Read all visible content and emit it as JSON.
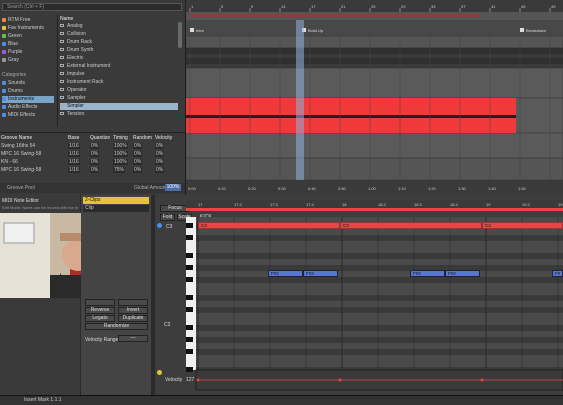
{
  "browser": {
    "search_placeholder": "Search (Ctrl + F)",
    "collections": [
      {
        "label": "RTM Free",
        "color": "#e8913a"
      },
      {
        "label": "Fav Instruments",
        "color": "#e8c33a"
      },
      {
        "label": "Green",
        "color": "#5fc24a"
      },
      {
        "label": "Blue",
        "color": "#4a8fe8"
      },
      {
        "label": "Purple",
        "color": "#9a5ad0"
      },
      {
        "label": "Gray",
        "color": "#9a9a9a"
      }
    ],
    "categories_heading": "Categories",
    "categories": [
      "Sounds",
      "Drums",
      "Instruments",
      "Audio Effects",
      "MIDI Effects"
    ],
    "selected_category": "Instruments",
    "column_header": "Name",
    "items": [
      "Analog",
      "Collision",
      "Drum Rack",
      "Drum Synth",
      "Electric",
      "External Instrument",
      "Impulse",
      "Instrument Rack",
      "Operator",
      "Sampler",
      "Simpler",
      "Tension"
    ],
    "selected_item": "Simpler"
  },
  "groove_pool": {
    "columns": [
      "Groove Name",
      "Base",
      "Quantize",
      "Timing",
      "Random",
      "Velocity"
    ],
    "rows": [
      {
        "name": "Swing 16ths 54",
        "base": "1/16",
        "quantize": "0%",
        "timing": "100%",
        "random": "0%",
        "velocity": "0%"
      },
      {
        "name": "MPC 16 Swing-58",
        "base": "1/16",
        "quantize": "0%",
        "timing": "100%",
        "random": "0%",
        "velocity": "0%"
      },
      {
        "name": "KN - 66",
        "base": "1/16",
        "quantize": "0%",
        "timing": "100%",
        "random": "0%",
        "velocity": "0%"
      },
      {
        "name": "MPC 16 Swing-58",
        "base": "1/16",
        "quantize": "0%",
        "timing": "75%",
        "random": "0%",
        "velocity": "0%"
      }
    ],
    "footer_left": "Groove Pool",
    "global_amount_label": "Global Amount",
    "global_amount_value": "100%"
  },
  "arrangement": {
    "ruler": [
      "1",
      "5",
      "9",
      "13",
      "17",
      "21",
      "25",
      "29",
      "33",
      "37",
      "41",
      "45",
      "49"
    ],
    "locators": [
      "Intro",
      "Build Up",
      "Breakdown"
    ],
    "time_marks": [
      "0:00",
      "0:10",
      "0:20",
      "0:30",
      "0:40",
      "0:50",
      "1:00",
      "1:10",
      "1:20",
      "1:30",
      "1:40",
      "1:50"
    ]
  },
  "note_editor": {
    "title": "MIDI Note Editor",
    "hint": "Edit Mode: Notes can be moved with the mouse or cursor keys...",
    "clip_label": "2-Clips",
    "clip_sub": "Clip",
    "buttons": [
      "Reverse",
      "Invert",
      "Legato",
      "Duplicate",
      "Randomize"
    ],
    "velocity_range_label": "Velocity Range",
    "velocity_range_value": "—",
    "fold_label": "Fold",
    "scale_label": "Scale",
    "key_label": "KICK",
    "focus_label": "Focus",
    "c3_label": "C3",
    "c2_label": "C2",
    "velocity_label": "Velocity",
    "velocity_value": "127",
    "ruler": [
      "17",
      "17.2",
      "17.3",
      "17.4",
      "18",
      "18.2",
      "18.3",
      "18.4",
      "19",
      "19.2",
      "19.3",
      "19.4"
    ],
    "bar_notes": [
      "C3",
      "C3",
      "C3"
    ],
    "blue_notes": [
      "F#2",
      "F#2",
      "F#2",
      "F#2",
      "F#"
    ]
  },
  "status_bar": {
    "text": "Insert Mark 1.1.1"
  }
}
